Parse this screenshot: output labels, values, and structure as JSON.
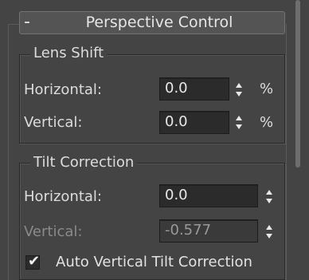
{
  "rollout": {
    "collapse_symbol": "-",
    "title": "Perspective Control"
  },
  "lens_shift": {
    "title": "Lens Shift",
    "horizontal": {
      "label": "Horizontal:",
      "value": "0.0",
      "unit": "%"
    },
    "vertical": {
      "label": "Vertical:",
      "value": "0.0",
      "unit": "%"
    }
  },
  "tilt_correction": {
    "title": "Tilt Correction",
    "horizontal": {
      "label": "Horizontal:",
      "value": "0.0"
    },
    "vertical": {
      "label": "Vertical:",
      "value": "-0.577"
    },
    "auto_vertical": {
      "label": "Auto Vertical Tilt Correction",
      "checked": true
    }
  },
  "icons": {
    "collapse": "minus-icon",
    "spinner": "spinner-up-down-icon",
    "check": "checkmark-icon"
  },
  "colors": {
    "background": "#444444",
    "field": "#2b2b2b",
    "text": "#dcdcdc",
    "disabled_text": "#8a8a8a"
  }
}
